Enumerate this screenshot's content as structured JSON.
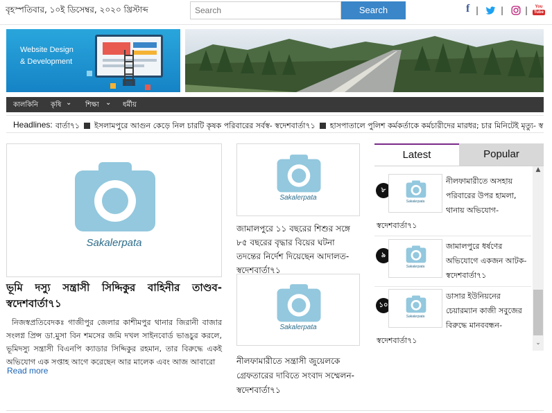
{
  "header": {
    "date": "বৃহস্পতিবার, ১০ই ডিসেম্বর, ২০২০ খ্রিস্টাব্দ",
    "search": {
      "placeholder": "Search",
      "button_label": "Search"
    },
    "social": [
      {
        "name": "facebook-icon",
        "glyph": "f",
        "color": "#3b5998"
      },
      {
        "name": "twitter-icon",
        "glyph": "🐦",
        "color": "#1da1f2"
      },
      {
        "name": "instagram-icon",
        "glyph": "◎",
        "color": "#c13584"
      },
      {
        "name": "youtube-icon",
        "glyph": "You Tube",
        "color": "#d62b2b"
      }
    ]
  },
  "banner": {
    "left_text_line1": "Website Design",
    "left_text_line2": "& Development"
  },
  "nav": {
    "items": [
      "কালকিনি",
      "কৃষি",
      "শিক্ষা",
      "ধর্মীয়"
    ],
    "dropdown_glyph": "⌄"
  },
  "headlines": {
    "label": "Headlines:",
    "items": [
      "বার্তা৭১",
      "ইসলামপুরে আগুন কেড়ে নিল চারটি কৃষক পরিবারের সর্বস্ব- স্বদেশবার্তা৭১",
      "হাসপাতালে পুলিশ কর্মকর্তাকে কর্মচারীদের মারধর; চার মিনিটেই মৃত্যু- স্ব"
    ]
  },
  "placeholder_label": "Sakalerpata",
  "main_article": {
    "title": "ভূমি দস্যু সন্ত্রাসী সিদ্দিকুর বাহিনীর তাণ্ডব- স্বদেশবার্তা৭১",
    "excerpt": "নিজস্বপ্রতিবেদকঃ গাজীপুর জেলার কাশীমপুর থানার জিরানী বাজার সংলগ্ন প্রিন্স ডা.মুসা বিন শমসের জমি দখল সাইনবোর্ড ভাঙচুর করলে, ভূমিদস্যু সন্ত্রাসী বিএনপি ক্যাডার সিদ্দিকুর রহমান, তার বিরুদ্ধে একই অভিযোগ এক সপ্তাহ আগে করেছেন আর মালেক এবং আজ আবারো",
    "read_more": "Read more"
  },
  "mid_articles": [
    {
      "title": "জামালপুরে ১১ বছরের শিশুর সঙ্গে ৮৫ বছরের বৃদ্ধার বিয়ের ঘটনা তদন্তের নির্দেশ দিয়েছেন আদালত- স্বদেশবার্তা৭১"
    },
    {
      "title": "নীলফামারীতে সন্ত্রাসী জুয়েলকে গ্রেফতারের দাবিতে সংবাদ সম্মেলন- স্বদেশবার্তা৭১"
    }
  ],
  "sidebar": {
    "tabs": [
      "Latest",
      "Popular"
    ],
    "active_tab": "Latest",
    "items": [
      {
        "num": "৮",
        "title": "নীলফামারীতে অসহায় পরিবারের উপর হামলা, থানায় অভিযোগ-",
        "tail": "স্বদেশবার্তা৭১"
      },
      {
        "num": "৯",
        "title": "জামালপুরে ধর্ষণের অভিযোগে একজন আটক- স্বদেশবার্তা৭১",
        "tail": ""
      },
      {
        "num": "১০",
        "title": "ডাসার ইউনিয়নের চেয়ারম্যান কাজী সবুজের বিরুদ্ধে মানববন্ধন-",
        "tail": "স্বদেশবার্তা৭১"
      }
    ]
  },
  "colors": {
    "accent_blue": "#3a86c8",
    "nav_bg": "#393939",
    "tab_border": "#7a2a88",
    "camera": "#93c8de"
  }
}
